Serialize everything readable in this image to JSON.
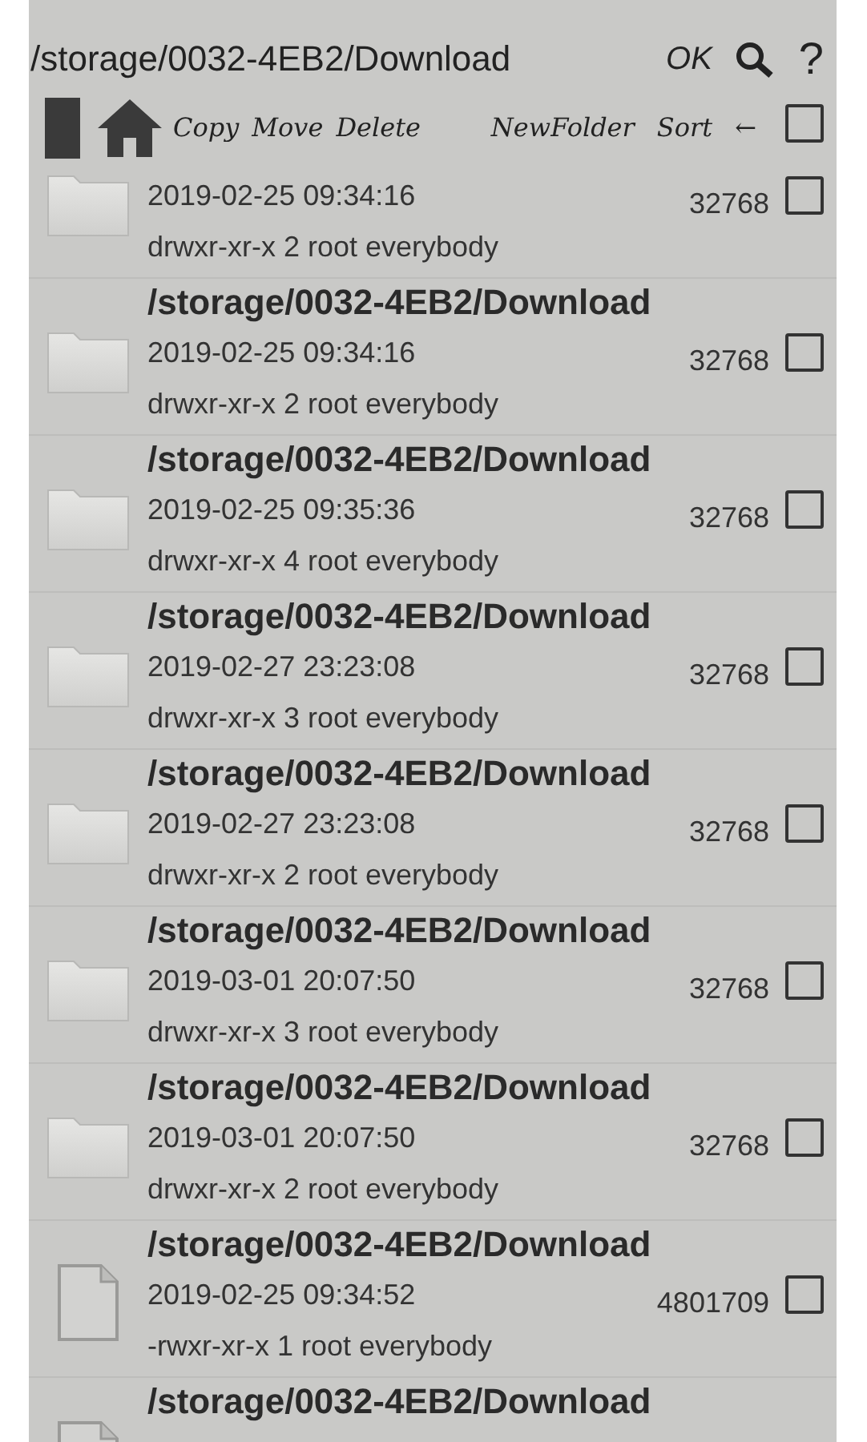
{
  "path_bar": {
    "path": "/storage/0032-4EB2/Download",
    "ok": "OK",
    "help": "?"
  },
  "toolbar": {
    "actions": [
      "Copy",
      "Move",
      "Delete"
    ],
    "actions_right": [
      "NewFolder",
      "Sort",
      "←"
    ],
    "select_all": {
      "checked": false
    }
  },
  "files": [
    {
      "kind": "folder",
      "date": "2019-02-25 09:34:16",
      "size": "32768",
      "perms": "drwxr-xr-x 2 root everybody",
      "checked": false
    },
    {
      "kind": "folder",
      "name": "/storage/0032-4EB2/Download",
      "date": "2019-02-25 09:34:16",
      "size": "32768",
      "perms": "drwxr-xr-x 2 root everybody",
      "checked": false
    },
    {
      "kind": "folder",
      "name": "/storage/0032-4EB2/Download",
      "date": "2019-02-25 09:35:36",
      "size": "32768",
      "perms": "drwxr-xr-x 4 root everybody",
      "checked": false
    },
    {
      "kind": "folder",
      "name": "/storage/0032-4EB2/Download",
      "date": "2019-02-27 23:23:08",
      "size": "32768",
      "perms": "drwxr-xr-x 3 root everybody",
      "checked": false
    },
    {
      "kind": "folder",
      "name": "/storage/0032-4EB2/Download",
      "date": "2019-02-27 23:23:08",
      "size": "32768",
      "perms": "drwxr-xr-x 2 root everybody",
      "checked": false
    },
    {
      "kind": "folder",
      "name": "/storage/0032-4EB2/Download",
      "date": "2019-03-01 20:07:50",
      "size": "32768",
      "perms": "drwxr-xr-x 3 root everybody",
      "checked": false
    },
    {
      "kind": "folder",
      "name": "/storage/0032-4EB2/Download",
      "date": "2019-03-01 20:07:50",
      "size": "32768",
      "perms": "drwxr-xr-x 2 root everybody",
      "checked": false
    },
    {
      "kind": "file",
      "name": "/storage/0032-4EB2/Download",
      "date": "2019-02-25 09:34:52",
      "size": "4801709",
      "perms": "-rwxr-xr-x 1 root everybody",
      "checked": false
    },
    {
      "kind": "file",
      "name": "/storage/0032-4EB2/Download"
    }
  ]
}
